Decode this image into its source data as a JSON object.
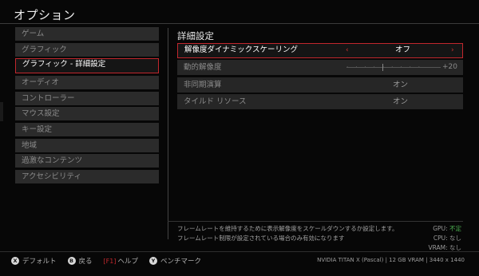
{
  "window": {
    "title": "オプション"
  },
  "menu": {
    "items": [
      {
        "label": "ゲーム",
        "selected": false
      },
      {
        "label": "グラフィック",
        "selected": false
      },
      {
        "label": "グラフィック - 詳細設定",
        "selected": true
      },
      {
        "label": "オーディオ",
        "selected": false
      },
      {
        "label": "コントローラー",
        "selected": false
      },
      {
        "label": "マウス設定",
        "selected": false
      },
      {
        "label": "キー設定",
        "selected": false
      },
      {
        "label": "地域",
        "selected": false
      },
      {
        "label": "過激なコンテンツ",
        "selected": false
      },
      {
        "label": "アクセシビリティ",
        "selected": false
      }
    ]
  },
  "section": {
    "title": "詳細設定"
  },
  "settings": [
    {
      "label": "解像度ダイナミックスケーリング",
      "value": "オフ",
      "selected": true,
      "left_arrow": "‹",
      "right_arrow": "›"
    },
    {
      "label": "動的解像度",
      "value": "+20",
      "slider_level": 0.38
    },
    {
      "label": "非同期演算",
      "value": "オン"
    },
    {
      "label": "タイルド リソース",
      "value": "オン"
    }
  ],
  "description": {
    "line1": "フレームレートを維持するために表示解像度をスケールダウンするか設定します。",
    "line2": "フレームレート制限が設定されている場合のみ有効になります"
  },
  "status": {
    "gpu_label": "GPU:",
    "gpu_value": "不定",
    "cpu_label": "CPU:",
    "cpu_value": "なし",
    "vram_label": "VRAM:",
    "vram_value": "なし"
  },
  "footer": {
    "default_btn": "X",
    "default_label": "デフォルト",
    "back_btn": "B",
    "back_label": "戻る",
    "help_key": "[F1]",
    "help_label": "ヘルプ",
    "bench_btn": "Y",
    "bench_label": "ベンチマーク",
    "sysinfo": "NVIDIA TITAN X (Pascal) | 12 GB VRAM | 3440 x 1440"
  },
  "colors": {
    "accent": "#c1272d",
    "status_warn": "#4caf50"
  }
}
